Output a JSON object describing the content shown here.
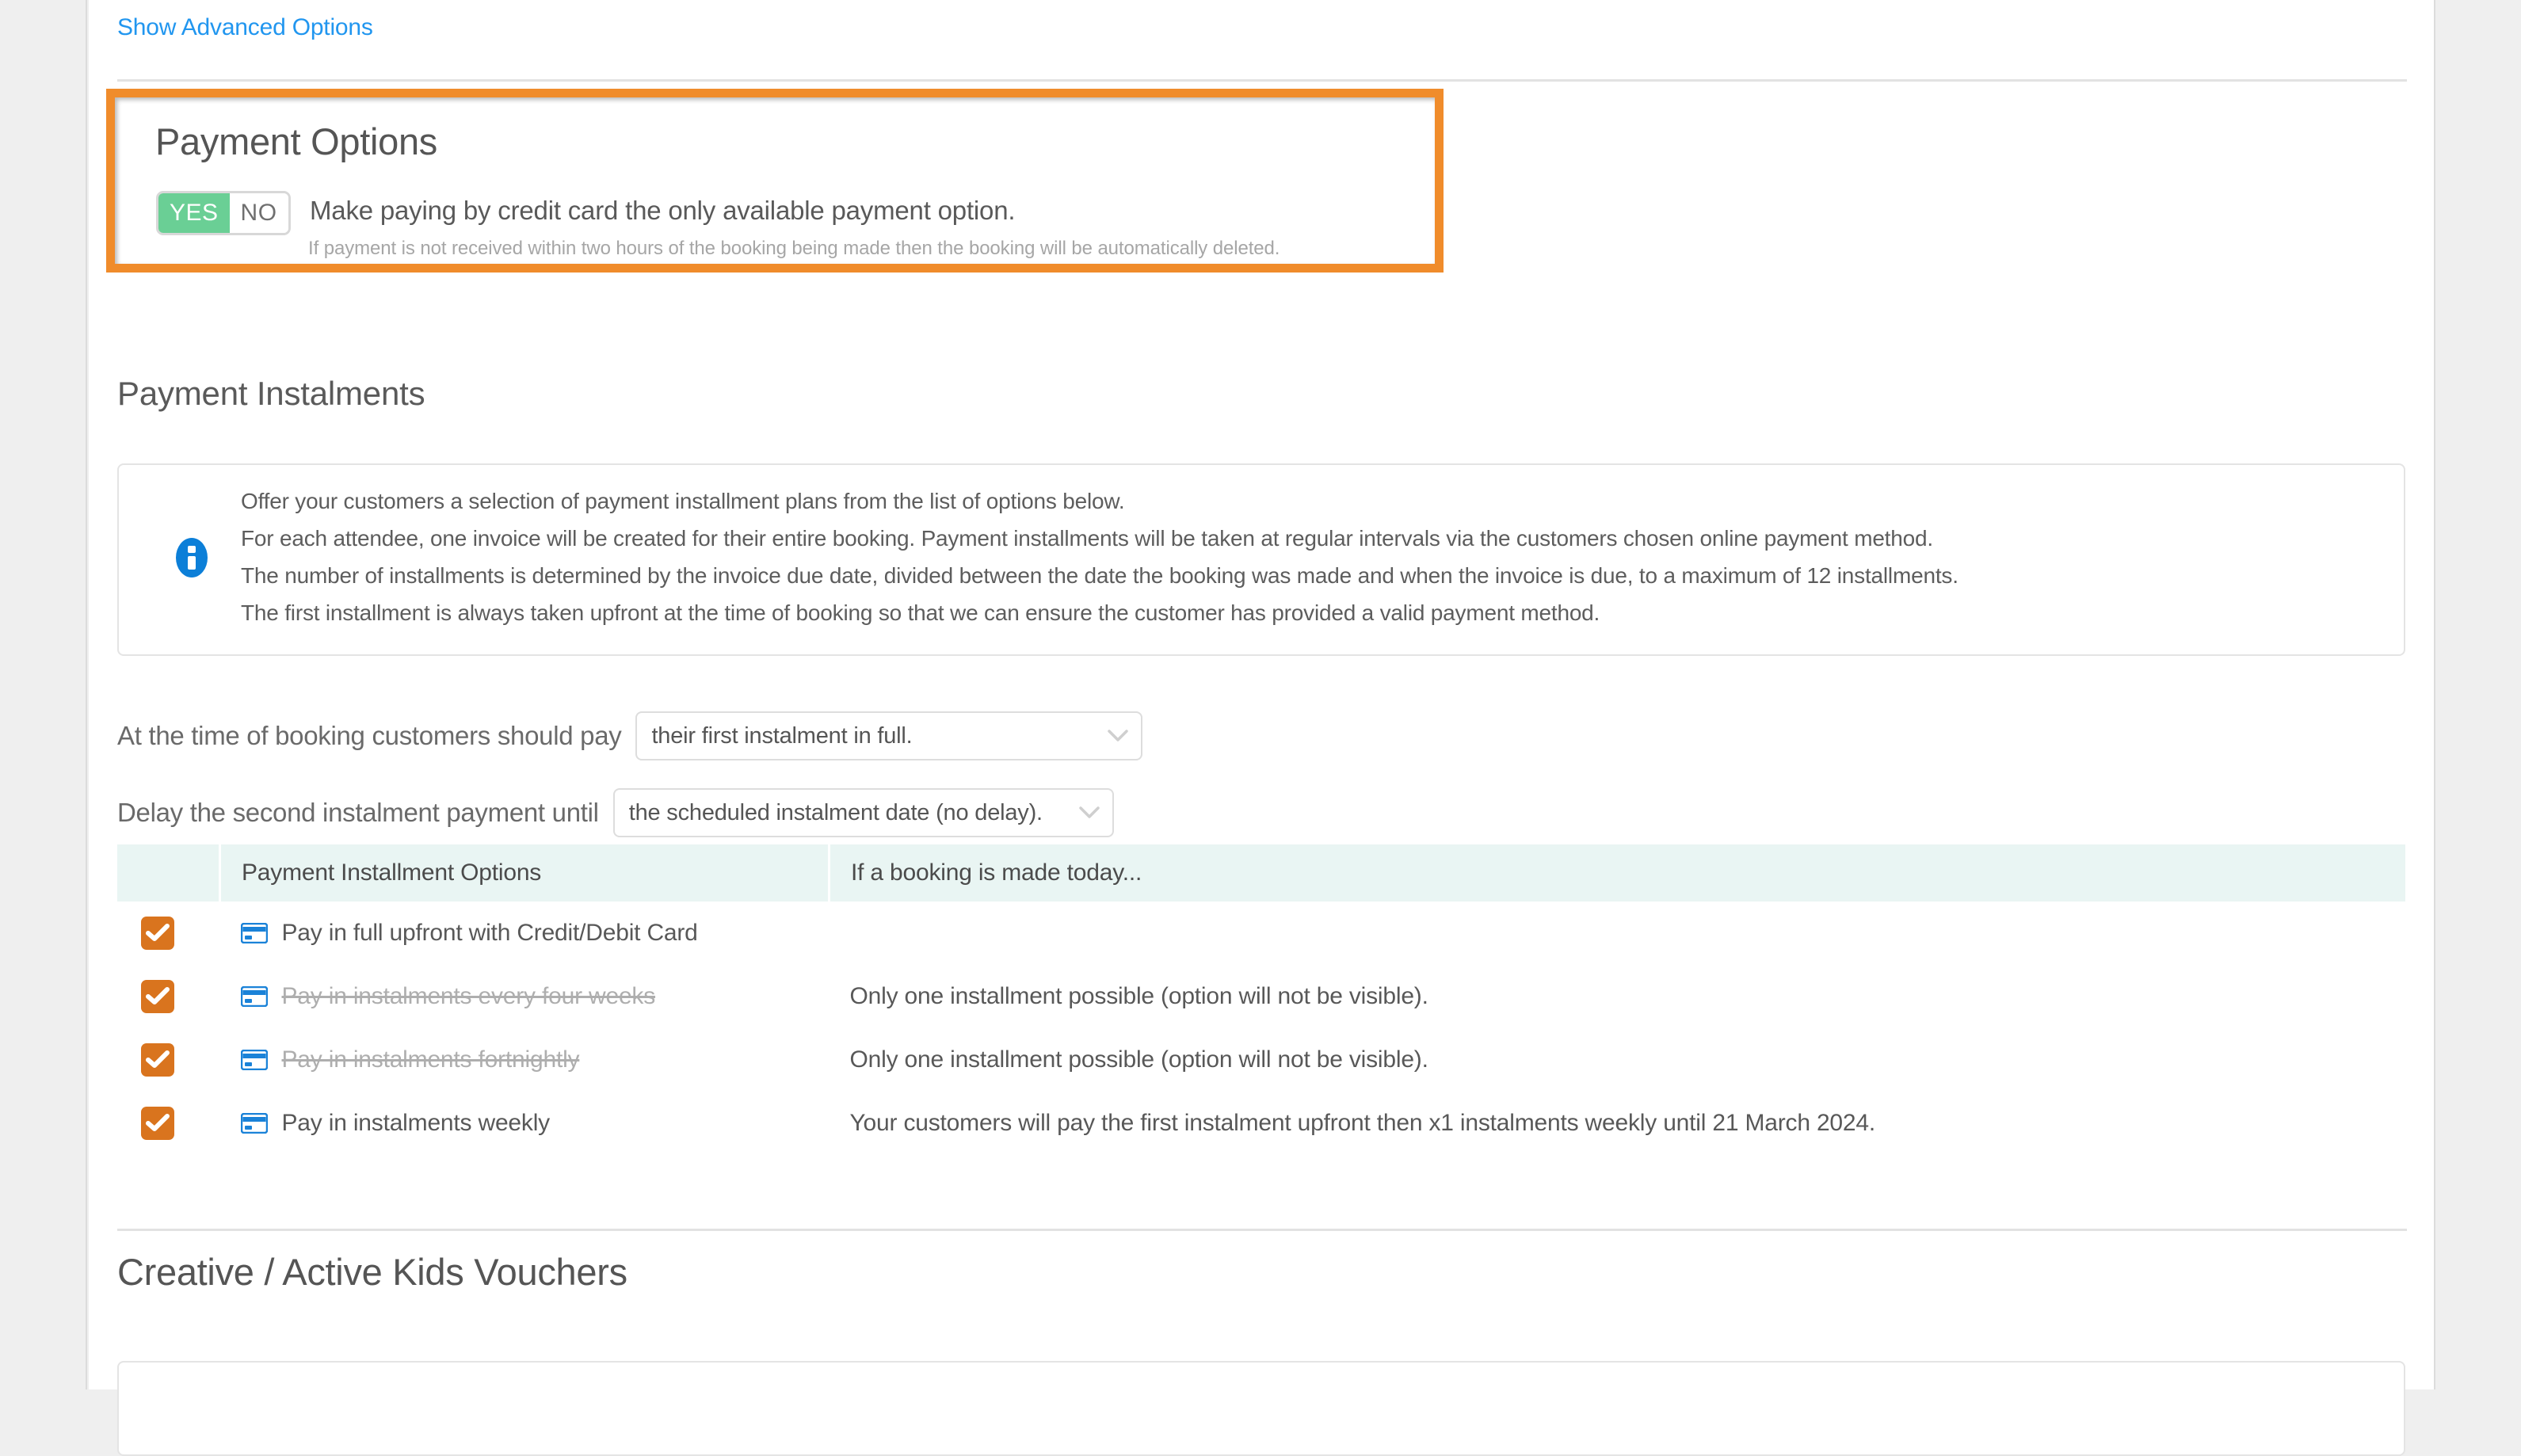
{
  "advanced_link": "Show Advanced Options",
  "payment_options": {
    "title": "Payment Options",
    "toggle": {
      "yes": "YES",
      "no": "NO",
      "selected": "YES"
    },
    "label": "Make paying by credit card the only available payment option.",
    "note": "If payment is not received within two hours of the booking being made then the booking will be automatically deleted.",
    "highlight_color": "#f08c2b",
    "on_color": "#6acf95"
  },
  "payment_instalments": {
    "title": "Payment Instalments",
    "info_icon": "info-circle-icon",
    "info_lines": [
      "Offer your customers a selection of payment installment plans from the list of options below.",
      "For each attendee, one invoice will be created for their entire booking. Payment installments will be taken at regular intervals via the customers chosen online payment method.",
      "The number of installments is determined by the invoice due date, divided between the date the booking was made and when the invoice is due, to a maximum of 12 installments.",
      "The first installment is always taken upfront at the time of booking so that we can ensure the customer has provided a valid payment method."
    ],
    "selects": [
      {
        "label": "At the time of booking customers should pay",
        "value": "their first instalment in full."
      },
      {
        "label": "Delay the second instalment payment until",
        "value": "the scheduled instalment date (no delay)."
      }
    ],
    "table": {
      "headers": [
        "",
        "Payment Installment Options",
        "If a booking is made today..."
      ],
      "rows": [
        {
          "checked": true,
          "icon": "credit-card-icon",
          "option": "Pay in full upfront with Credit/Debit Card",
          "struck": false,
          "message": ""
        },
        {
          "checked": true,
          "icon": "credit-card-icon",
          "option": "Pay in instalments every four weeks",
          "struck": true,
          "message": "Only one installment possible (option will not be visible)."
        },
        {
          "checked": true,
          "icon": "credit-card-icon",
          "option": "Pay in instalments fortnightly",
          "struck": true,
          "message": "Only one installment possible (option will not be visible)."
        },
        {
          "checked": true,
          "icon": "credit-card-icon",
          "option": "Pay in instalments weekly",
          "struck": false,
          "message": "Your customers will pay the first instalment upfront then x1 instalments weekly until 21 March 2024."
        }
      ],
      "header_bg": "#e9f5f3",
      "checkbox_color": "#d9741e",
      "card_icon_color": "#1a82d8"
    }
  },
  "vouchers": {
    "title": "Creative / Active Kids Vouchers"
  }
}
